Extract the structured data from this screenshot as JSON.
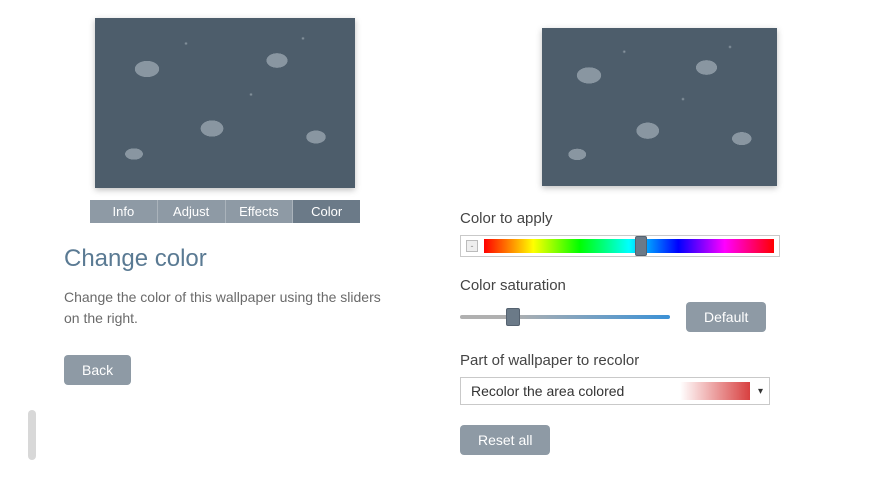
{
  "tabs": {
    "info": "Info",
    "adjust": "Adjust",
    "effects": "Effects",
    "color": "Color",
    "active": "color"
  },
  "panel": {
    "title": "Change color",
    "description": "Change the color of this wallpaper using the sliders on the right.",
    "back_label": "Back"
  },
  "controls": {
    "hue": {
      "label": "Color to apply",
      "value_percent": 54
    },
    "saturation": {
      "label": "Color saturation",
      "value_percent": 25,
      "default_label": "Default"
    },
    "recolor": {
      "label": "Part of wallpaper to recolor",
      "selected": "Recolor the area colored",
      "swatch_color": "#d84040"
    },
    "reset_label": "Reset all"
  }
}
